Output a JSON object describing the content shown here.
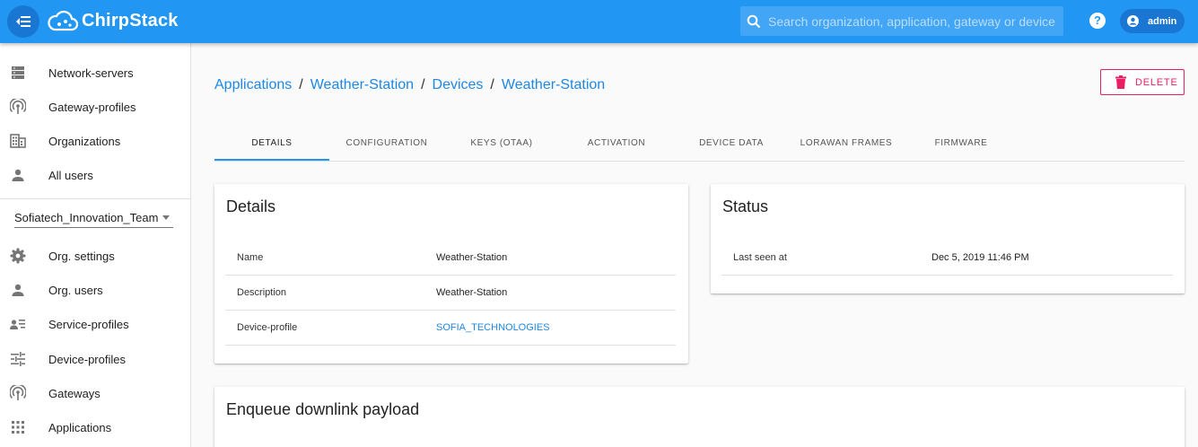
{
  "app": {
    "name": "ChirpStack"
  },
  "header": {
    "search_placeholder": "Search organization, application, gateway or device",
    "help_label": "?",
    "user": "admin"
  },
  "sidebar": {
    "items": [
      {
        "label": "Network-servers",
        "icon": "server-icon"
      },
      {
        "label": "Gateway-profiles",
        "icon": "antenna-icon"
      },
      {
        "label": "Organizations",
        "icon": "building-icon"
      },
      {
        "label": "All users",
        "icon": "person-icon"
      }
    ],
    "org_selected": "Sofiatech_Innovation_Team",
    "org_items": [
      {
        "label": "Org. settings",
        "icon": "gear-icon"
      },
      {
        "label": "Org. users",
        "icon": "person-icon"
      },
      {
        "label": "Service-profiles",
        "icon": "account-list-icon"
      },
      {
        "label": "Device-profiles",
        "icon": "tune-icon"
      },
      {
        "label": "Gateways",
        "icon": "antenna-icon"
      },
      {
        "label": "Applications",
        "icon": "apps-grid-icon"
      }
    ]
  },
  "breadcrumb": [
    "Applications",
    "Weather-Station",
    "Devices",
    "Weather-Station"
  ],
  "breadcrumb_sep": "/",
  "delete_label": "DELETE",
  "tabs": [
    "DETAILS",
    "CONFIGURATION",
    "KEYS (OTAA)",
    "ACTIVATION",
    "DEVICE DATA",
    "LORAWAN FRAMES",
    "FIRMWARE"
  ],
  "details": {
    "title": "Details",
    "rows": [
      {
        "key": "Name",
        "value": "Weather-Station"
      },
      {
        "key": "Description",
        "value": "Weather-Station"
      },
      {
        "key": "Device-profile",
        "value": "SOFIA_TECHNOLOGIES"
      }
    ]
  },
  "status": {
    "title": "Status",
    "rows": [
      {
        "key": "Last seen at",
        "value": "Dec 5, 2019 11:46 PM"
      }
    ]
  },
  "downlink": {
    "title": "Enqueue downlink payload"
  },
  "colors": {
    "primary": "#2196f3",
    "primary_dark": "#1976d2",
    "danger": "#e91e63",
    "link": "#1e88e5"
  }
}
